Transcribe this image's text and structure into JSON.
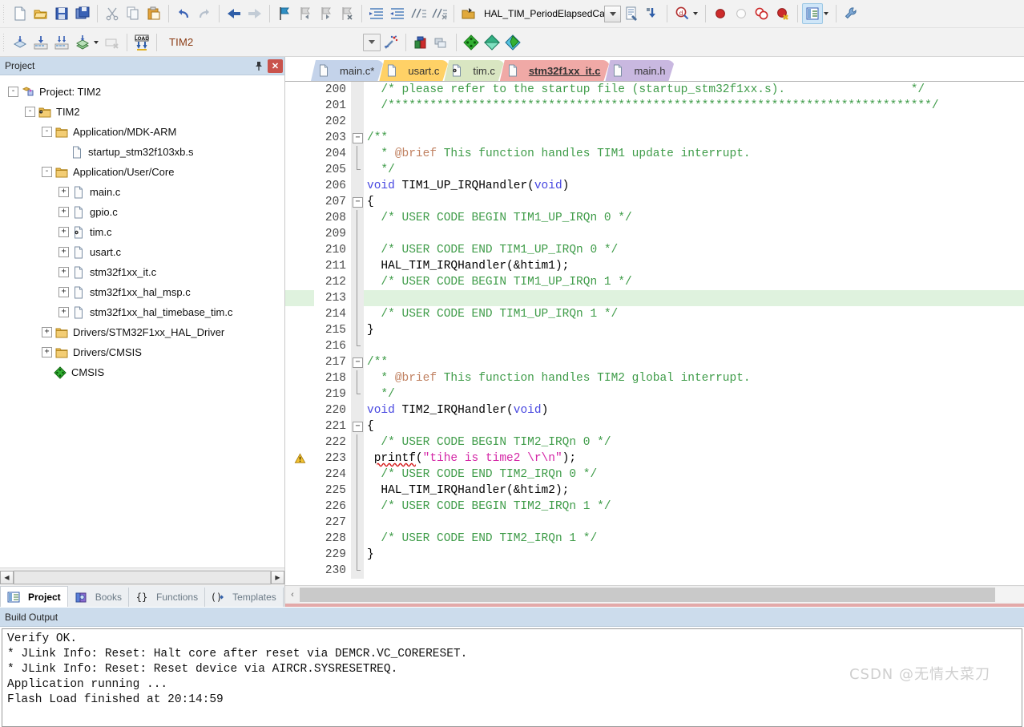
{
  "toolbar1": {
    "buttons": [
      {
        "name": "new-file",
        "icon": "new-file-icon"
      },
      {
        "name": "open-file",
        "icon": "open-folder-icon"
      },
      {
        "name": "save",
        "icon": "save-icon"
      },
      {
        "name": "save-all",
        "icon": "save-all-icon"
      },
      {
        "name": "cut",
        "icon": "scissors-icon"
      },
      {
        "name": "copy",
        "icon": "copy-icon"
      },
      {
        "name": "paste",
        "icon": "paste-icon"
      },
      {
        "name": "undo",
        "icon": "undo-arrow-icon"
      },
      {
        "name": "redo",
        "icon": "redo-arrow-icon"
      },
      {
        "name": "navigate-back",
        "icon": "back-arrow-icon"
      },
      {
        "name": "navigate-forward",
        "icon": "forward-arrow-icon"
      },
      {
        "name": "toggle-bookmark",
        "icon": "bookmark-flag-icon"
      },
      {
        "name": "previous-bookmark",
        "icon": "bookmark-prev-icon"
      },
      {
        "name": "next-bookmark",
        "icon": "bookmark-next-icon"
      },
      {
        "name": "clear-bookmarks",
        "icon": "bookmark-clear-icon"
      },
      {
        "name": "indent-right",
        "icon": "indent-right-icon"
      },
      {
        "name": "indent-left",
        "icon": "indent-left-icon"
      },
      {
        "name": "comment-lines",
        "icon": "comment-icon"
      },
      {
        "name": "uncomment-lines",
        "icon": "uncomment-icon"
      }
    ],
    "function_combo_value": "HAL_TIM_PeriodElapsedCall",
    "right_buttons": [
      {
        "name": "insert-file",
        "icon": "insert-file-icon"
      },
      {
        "name": "configure-bookmarks",
        "icon": "configure-icon"
      },
      {
        "name": "find-in-files",
        "icon": "magnifier-icon"
      },
      {
        "name": "insert-breakpoint",
        "icon": "breakpoint-red-dot-icon"
      },
      {
        "name": "disable-breakpoint",
        "icon": "breakpoint-hollow-icon"
      },
      {
        "name": "kill-all-breakpoints",
        "icon": "breakpoint-pair-icon"
      },
      {
        "name": "kill-breakpoint",
        "icon": "breakpoint-x-icon"
      },
      {
        "name": "window-layout",
        "icon": "window-layout-icon"
      },
      {
        "name": "configure-target",
        "icon": "wrench-icon"
      }
    ]
  },
  "toolbar2": {
    "buttons": [
      {
        "name": "translate-file",
        "icon": "translate-icon"
      },
      {
        "name": "build-target",
        "icon": "build-icon"
      },
      {
        "name": "rebuild-all",
        "icon": "rebuild-icon"
      },
      {
        "name": "batch-build",
        "icon": "batch-build-icon"
      },
      {
        "name": "stop-build",
        "icon": "stop-build-icon"
      },
      {
        "name": "download-to-flash",
        "icon": "load-download-icon"
      }
    ],
    "target_name": "TIM2",
    "right_buttons": [
      {
        "name": "start-debug",
        "icon": "debug-magic-icon"
      },
      {
        "name": "manage-project-items",
        "icon": "project-items-icon"
      },
      {
        "name": "manage-multi-project",
        "icon": "multi-project-icon"
      },
      {
        "name": "run-time-environment",
        "icon": "green-diamond-icon"
      },
      {
        "name": "pack-installer",
        "icon": "pack-installer-icon"
      },
      {
        "name": "manage-run-time",
        "icon": "rte-globe-icon"
      }
    ]
  },
  "project_panel": {
    "title": "Project",
    "pin_icon": "pin-icon",
    "close_icon": "close-icon",
    "tree": [
      {
        "label": "Project: TIM2",
        "depth": 0,
        "expander": "-",
        "icon": "project-icon"
      },
      {
        "label": "TIM2",
        "depth": 1,
        "expander": "-",
        "icon": "target-icon"
      },
      {
        "label": "Application/MDK-ARM",
        "depth": 2,
        "expander": "-",
        "icon": "folder-icon"
      },
      {
        "label": "startup_stm32f103xb.s",
        "depth": 3,
        "expander": "",
        "icon": "file-icon"
      },
      {
        "label": "Application/User/Core",
        "depth": 2,
        "expander": "-",
        "icon": "folder-icon"
      },
      {
        "label": "main.c",
        "depth": 3,
        "expander": "+",
        "icon": "file-icon"
      },
      {
        "label": "gpio.c",
        "depth": 3,
        "expander": "+",
        "icon": "file-icon"
      },
      {
        "label": "tim.c",
        "depth": 3,
        "expander": "+",
        "icon": "file-gear-icon"
      },
      {
        "label": "usart.c",
        "depth": 3,
        "expander": "+",
        "icon": "file-icon"
      },
      {
        "label": "stm32f1xx_it.c",
        "depth": 3,
        "expander": "+",
        "icon": "file-icon"
      },
      {
        "label": "stm32f1xx_hal_msp.c",
        "depth": 3,
        "expander": "+",
        "icon": "file-icon"
      },
      {
        "label": "stm32f1xx_hal_timebase_tim.c",
        "depth": 3,
        "expander": "+",
        "icon": "file-icon"
      },
      {
        "label": "Drivers/STM32F1xx_HAL_Driver",
        "depth": 2,
        "expander": "+",
        "icon": "folder-icon"
      },
      {
        "label": "Drivers/CMSIS",
        "depth": 2,
        "expander": "+",
        "icon": "folder-icon"
      },
      {
        "label": "CMSIS",
        "depth": 2,
        "expander": "",
        "icon": "green-diamond-icon"
      }
    ],
    "bottom_tabs": [
      {
        "label": "Project",
        "icon": "project-tab-icon",
        "active": true
      },
      {
        "label": "Books",
        "icon": "books-icon",
        "active": false
      },
      {
        "label": "Functions",
        "icon": "braces-icon",
        "active": false
      },
      {
        "label": "Templates",
        "icon": "templates-icon",
        "active": false
      }
    ],
    "scroll_left_icon": "left-arrow-icon",
    "scroll_right_icon": "right-arrow-icon"
  },
  "editor": {
    "tabs": [
      {
        "label": "main.c*",
        "color": "#c4d3ea",
        "active": false,
        "icon": "file-icon"
      },
      {
        "label": "usart.c",
        "color": "#ffd166",
        "active": false,
        "icon": "file-icon"
      },
      {
        "label": "tim.c",
        "color": "#d9e6c2",
        "active": false,
        "icon": "file-gear-icon"
      },
      {
        "label": "stm32f1xx_it.c",
        "color": "#f0a9a6",
        "active": true,
        "icon": "file-icon"
      },
      {
        "label": "main.h",
        "color": "#c9b8e0",
        "active": false,
        "icon": "file-icon"
      }
    ],
    "lines": [
      {
        "n": "200",
        "fold": "none",
        "warn": false,
        "hl": false,
        "tokens": [
          {
            "t": "  ",
            "c": "pl"
          },
          {
            "t": "/* please refer to the startup file (startup_stm32f1xx.s).                  */",
            "c": "cm"
          }
        ]
      },
      {
        "n": "201",
        "fold": "none",
        "warn": false,
        "hl": false,
        "tokens": [
          {
            "t": "  ",
            "c": "pl"
          },
          {
            "t": "/******************************************************************************/",
            "c": "cm"
          }
        ]
      },
      {
        "n": "202",
        "fold": "none",
        "warn": false,
        "hl": false,
        "tokens": [
          {
            "t": "",
            "c": "pl"
          }
        ]
      },
      {
        "n": "203",
        "fold": "minus",
        "warn": false,
        "hl": false,
        "tokens": [
          {
            "t": "/**",
            "c": "cm"
          }
        ]
      },
      {
        "n": "204",
        "fold": "bar",
        "warn": false,
        "hl": false,
        "tokens": [
          {
            "t": "  * ",
            "c": "cm"
          },
          {
            "t": "@brief",
            "c": "br"
          },
          {
            "t": " This function handles TIM1 update interrupt.",
            "c": "cm"
          }
        ]
      },
      {
        "n": "205",
        "fold": "end",
        "warn": false,
        "hl": false,
        "tokens": [
          {
            "t": "  */",
            "c": "cm"
          }
        ]
      },
      {
        "n": "206",
        "fold": "none",
        "warn": false,
        "hl": false,
        "tokens": [
          {
            "t": "",
            "c": "pl"
          },
          {
            "t": "void",
            "c": "kw"
          },
          {
            "t": " TIM1_UP_IRQHandler(",
            "c": "pl"
          },
          {
            "t": "void",
            "c": "kw"
          },
          {
            "t": ")",
            "c": "pl"
          }
        ]
      },
      {
        "n": "207",
        "fold": "minus",
        "warn": false,
        "hl": false,
        "tokens": [
          {
            "t": "{",
            "c": "pl"
          }
        ]
      },
      {
        "n": "208",
        "fold": "bar",
        "warn": false,
        "hl": false,
        "tokens": [
          {
            "t": "  ",
            "c": "pl"
          },
          {
            "t": "/* USER CODE BEGIN TIM1_UP_IRQn 0 */",
            "c": "cm"
          }
        ]
      },
      {
        "n": "209",
        "fold": "bar",
        "warn": false,
        "hl": false,
        "tokens": [
          {
            "t": "",
            "c": "pl"
          }
        ]
      },
      {
        "n": "210",
        "fold": "bar",
        "warn": false,
        "hl": false,
        "tokens": [
          {
            "t": "  ",
            "c": "pl"
          },
          {
            "t": "/* USER CODE END TIM1_UP_IRQn 0 */",
            "c": "cm"
          }
        ]
      },
      {
        "n": "211",
        "fold": "bar",
        "warn": false,
        "hl": false,
        "tokens": [
          {
            "t": "  HAL_TIM_IRQHandler(&htim1);",
            "c": "pl"
          }
        ]
      },
      {
        "n": "212",
        "fold": "bar",
        "warn": false,
        "hl": false,
        "tokens": [
          {
            "t": "  ",
            "c": "pl"
          },
          {
            "t": "/* USER CODE BEGIN TIM1_UP_IRQn 1 */",
            "c": "cm"
          }
        ]
      },
      {
        "n": "213",
        "fold": "bar",
        "warn": false,
        "hl": true,
        "tokens": [
          {
            "t": "",
            "c": "pl"
          }
        ]
      },
      {
        "n": "214",
        "fold": "bar",
        "warn": false,
        "hl": false,
        "tokens": [
          {
            "t": "  ",
            "c": "pl"
          },
          {
            "t": "/* USER CODE END TIM1_UP_IRQn 1 */",
            "c": "cm"
          }
        ]
      },
      {
        "n": "215",
        "fold": "bar",
        "warn": false,
        "hl": false,
        "tokens": [
          {
            "t": "}",
            "c": "pl"
          }
        ]
      },
      {
        "n": "216",
        "fold": "end",
        "warn": false,
        "hl": false,
        "tokens": [
          {
            "t": "",
            "c": "pl"
          }
        ]
      },
      {
        "n": "217",
        "fold": "minus",
        "warn": false,
        "hl": false,
        "tokens": [
          {
            "t": "/**",
            "c": "cm"
          }
        ]
      },
      {
        "n": "218",
        "fold": "bar",
        "warn": false,
        "hl": false,
        "tokens": [
          {
            "t": "  * ",
            "c": "cm"
          },
          {
            "t": "@brief",
            "c": "br"
          },
          {
            "t": " This function handles TIM2 global interrupt.",
            "c": "cm"
          }
        ]
      },
      {
        "n": "219",
        "fold": "end",
        "warn": false,
        "hl": false,
        "tokens": [
          {
            "t": "  */",
            "c": "cm"
          }
        ]
      },
      {
        "n": "220",
        "fold": "none",
        "warn": false,
        "hl": false,
        "tokens": [
          {
            "t": "",
            "c": "pl"
          },
          {
            "t": "void",
            "c": "kw"
          },
          {
            "t": " TIM2_IRQHandler(",
            "c": "pl"
          },
          {
            "t": "void",
            "c": "kw"
          },
          {
            "t": ")",
            "c": "pl"
          }
        ]
      },
      {
        "n": "221",
        "fold": "minus",
        "warn": false,
        "hl": false,
        "tokens": [
          {
            "t": "{",
            "c": "pl"
          }
        ]
      },
      {
        "n": "222",
        "fold": "bar",
        "warn": false,
        "hl": false,
        "tokens": [
          {
            "t": "  ",
            "c": "pl"
          },
          {
            "t": "/* USER CODE BEGIN TIM2_IRQn 0 */",
            "c": "cm"
          }
        ]
      },
      {
        "n": "223",
        "fold": "bar",
        "warn": true,
        "hl": false,
        "tokens": [
          {
            "t": " ",
            "c": "pl"
          },
          {
            "t": "printf",
            "c": "squig"
          },
          {
            "t": "(",
            "c": "pl"
          },
          {
            "t": "\"tihe is time2 \\r\\n\"",
            "c": "str"
          },
          {
            "t": ");",
            "c": "pl"
          }
        ]
      },
      {
        "n": "224",
        "fold": "bar",
        "warn": false,
        "hl": false,
        "tokens": [
          {
            "t": "  ",
            "c": "pl"
          },
          {
            "t": "/* USER CODE END TIM2_IRQn 0 */",
            "c": "cm"
          }
        ]
      },
      {
        "n": "225",
        "fold": "bar",
        "warn": false,
        "hl": false,
        "tokens": [
          {
            "t": "  HAL_TIM_IRQHandler(&htim2);",
            "c": "pl"
          }
        ]
      },
      {
        "n": "226",
        "fold": "bar",
        "warn": false,
        "hl": false,
        "tokens": [
          {
            "t": "  ",
            "c": "pl"
          },
          {
            "t": "/* USER CODE BEGIN TIM2_IRQn 1 */",
            "c": "cm"
          }
        ]
      },
      {
        "n": "227",
        "fold": "bar",
        "warn": false,
        "hl": false,
        "tokens": [
          {
            "t": "",
            "c": "pl"
          }
        ]
      },
      {
        "n": "228",
        "fold": "bar",
        "warn": false,
        "hl": false,
        "tokens": [
          {
            "t": "  ",
            "c": "pl"
          },
          {
            "t": "/* USER CODE END TIM2_IRQn 1 */",
            "c": "cm"
          }
        ]
      },
      {
        "n": "229",
        "fold": "bar",
        "warn": false,
        "hl": false,
        "tokens": [
          {
            "t": "}",
            "c": "pl"
          }
        ]
      },
      {
        "n": "230",
        "fold": "end",
        "warn": false,
        "hl": false,
        "tokens": [
          {
            "t": "",
            "c": "pl"
          }
        ]
      }
    ],
    "warn_icon": "warning-triangle-icon"
  },
  "build_output": {
    "title": "Build Output",
    "lines": [
      "Verify OK.",
      "* JLink Info: Reset: Halt core after reset via DEMCR.VC_CORERESET.",
      "* JLink Info: Reset: Reset device via AIRCR.SYSRESETREQ.",
      "Application running ...",
      "Flash Load finished at 20:14:59"
    ]
  },
  "watermark": "CSDN @无情大菜刀",
  "colors": {
    "comment": "#3f9c49",
    "keyword": "#4646e0",
    "string": "#d425a6",
    "doc_tag": "#c08060",
    "current_line": "#dff2de",
    "panel_header": "#ccdcec",
    "active_tab": "#f0a9a6"
  }
}
